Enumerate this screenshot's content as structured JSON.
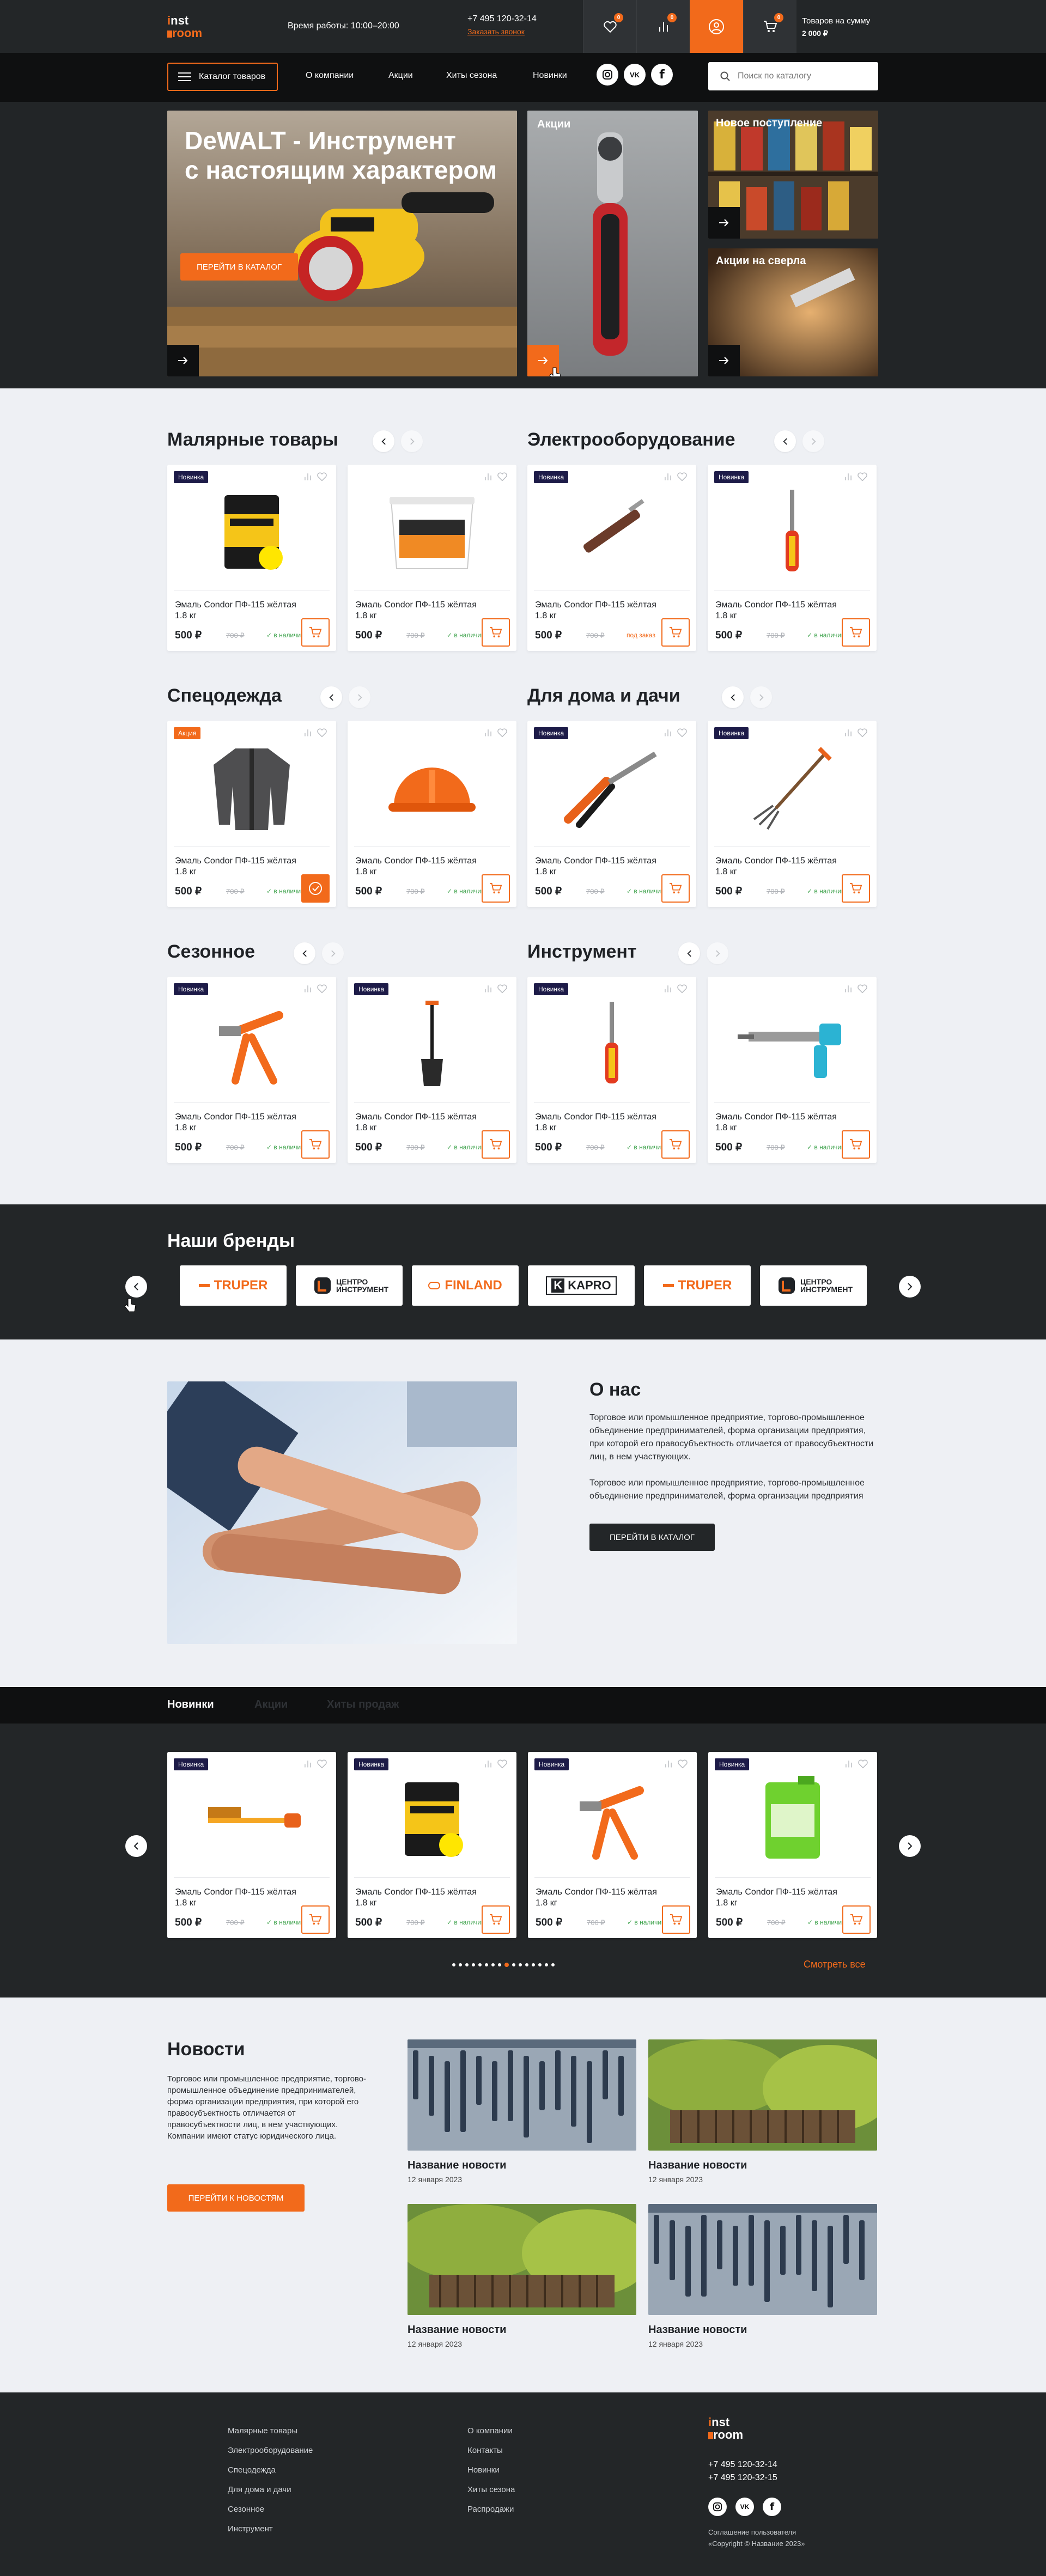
{
  "header": {
    "logo_line1": "inst",
    "logo_line2": "room",
    "hours_label": "Время работы:  10:00–20:00",
    "phone": "+7 495 120-32-14",
    "callback": "Заказать звонок",
    "favorites_count": "0",
    "compare_count": "0",
    "cart_count": "0",
    "cart_label": "Товаров на сумму",
    "cart_sum": "2 000 ₽"
  },
  "nav": {
    "catalog": "Каталог товаров",
    "items": [
      "О компании",
      "Акции",
      "Хиты сезона",
      "Новинки"
    ],
    "social": [
      "instagram-icon",
      "vk-icon",
      "facebook-icon"
    ],
    "search_placeholder": "Поиск по каталогу"
  },
  "hero": {
    "title_line1": "DeWALT - Инструмент",
    "title_line2": "с настоящим характером",
    "cta": "ПЕРЕЙТИ В КАТАЛОГ",
    "promo_title": "Акции",
    "new_title": "Новое поступление",
    "drill_title": "Акции на сверла"
  },
  "sections": [
    {
      "title": "Малярные товары"
    },
    {
      "title": "Электрооборудование"
    },
    {
      "title": "Спецодежда"
    },
    {
      "title": "Для дома и дачи"
    },
    {
      "title": "Сезонное"
    },
    {
      "title": "Инструмент"
    }
  ],
  "product": {
    "name_line1": "Эмаль Condor ПФ-115 жёлтая",
    "name_line2": "1.8 кг",
    "price": "500 ₽",
    "old_price": "700 ₽",
    "in_stock": "✓ в наличии",
    "on_order": "под заказ",
    "tag_new": "Новинка",
    "tag_sale": "Акция"
  },
  "brands": {
    "title": "Наши бренды",
    "items": [
      "TRUPER",
      "ЦЕНТРО ИНСТРУМЕНТ",
      "FINLAND",
      "KAPRO",
      "TRUPER",
      "ЦЕНТРО ИНСТРУМЕНТ"
    ]
  },
  "about": {
    "title": "О нас",
    "p1": "Торговое или промышленное предприятие, торгово-промышленное объединение предпринимателей, форма организации предприятия, при которой его правосубъектность отличается от правосубъектности лиц, в нем участвующих.",
    "p2": "Торговое или промышленное предприятие, торгово-промышленное объединение предпринимателей, форма организации предприятия",
    "cta": "ПЕРЕЙТИ В КАТАЛОГ"
  },
  "new_block": {
    "tabs": [
      "Новинки",
      "Акции",
      "Хиты продаж"
    ],
    "see_all": "Смотреть все"
  },
  "news": {
    "title": "Новости",
    "text": "Торговое или промышленное предприятие, торгово-промышленное объединение предпринимателей, форма организации предприятия, при которой его правосубъектность отличается от правосубъектности лиц, в нем участвующих. Компании имеют статус юридического лица.",
    "cta": "ПЕРЕЙТИ К НОВОСТЯМ",
    "item_title": "Название новости",
    "item_date": "12 января 2023"
  },
  "footer": {
    "col1": [
      "Малярные товары",
      "Электрооборудование",
      "Спецодежда",
      "Для дома и дачи",
      "Сезонное",
      "Инструмент"
    ],
    "col2": [
      "О компании",
      "Контакты",
      "Новинки",
      "Хиты сезона",
      "Распродажи"
    ],
    "phone1": "+7 495 120-32-14",
    "phone2": "+7 495 120-32-15",
    "agreement": "Соглашение пользователя",
    "copyright": "«Copyright © Название 2023»"
  },
  "colors": {
    "accent": "#f26a1b",
    "dark": "#232628",
    "black": "#0f1011",
    "bg": "#eef0f4",
    "new_tag": "#1d1b48"
  }
}
